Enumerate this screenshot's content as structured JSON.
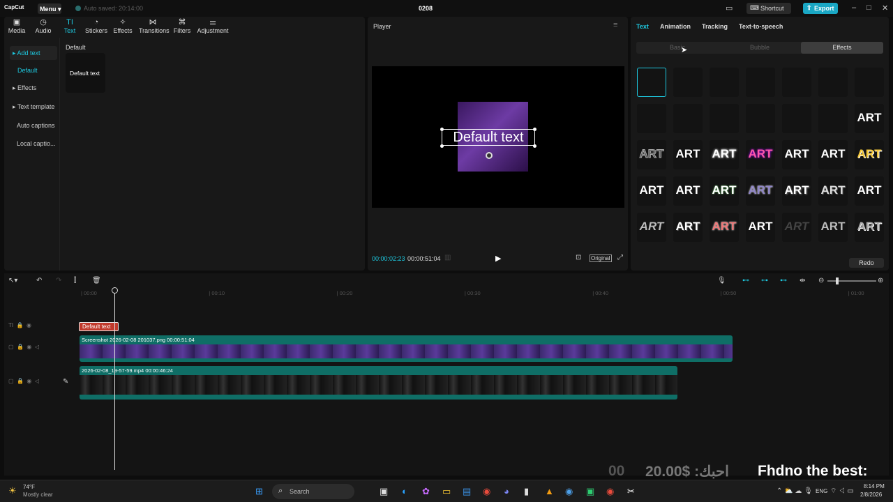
{
  "app": {
    "logo": "CapCut",
    "menu": "Menu",
    "saved": "Auto saved: 20:14:00",
    "title": "0208",
    "shortcut": "Shortcut",
    "export": "Export"
  },
  "toolbar": [
    {
      "label": "Media",
      "icon": "media-icon"
    },
    {
      "label": "Audio",
      "icon": "audio-icon"
    },
    {
      "label": "Text",
      "icon": "text-icon"
    },
    {
      "label": "Stickers",
      "icon": "stickers-icon"
    },
    {
      "label": "Effects",
      "icon": "effects-icon"
    },
    {
      "label": "Transitions",
      "icon": "transitions-icon"
    },
    {
      "label": "Filters",
      "icon": "filters-icon"
    },
    {
      "label": "Adjustment",
      "icon": "adjustment-icon"
    }
  ],
  "sidenav": [
    "Add text",
    "Default",
    "Effects",
    "Text template",
    "Auto captions",
    "Local captio..."
  ],
  "library": {
    "heading": "Default",
    "card": "Default text"
  },
  "player": {
    "title": "Player",
    "text": "Default text",
    "current": "00:00:02:23",
    "duration": "00:00:51:04",
    "ratio": "Original"
  },
  "right": {
    "tabs": [
      "Text",
      "Animation",
      "Tracking",
      "Text-to-speech"
    ],
    "segments": [
      "Basic",
      "Bubble",
      "Effects"
    ],
    "redo": "Redo",
    "art": "ART"
  },
  "timeline": {
    "ruler": [
      "00:00",
      "00:10",
      "00:20",
      "00:30",
      "00:40",
      "00:50",
      "01:00"
    ],
    "text_clip": "Default text",
    "clip1": "Screenshot 2026-02-08 201037.png  00:00:51:04",
    "clip2": "2026-02-08_19-57-59.mp4  00:00:46:24"
  },
  "overlay": {
    "left": "00",
    "price": "20.00$ :احبك",
    "right": "Fhdno the best:"
  },
  "taskbar": {
    "temp": "74°F",
    "weather": "Mostly clear",
    "search": "Search",
    "lang": "ENG",
    "time": "8:14 PM",
    "date": "2/8/2026"
  }
}
